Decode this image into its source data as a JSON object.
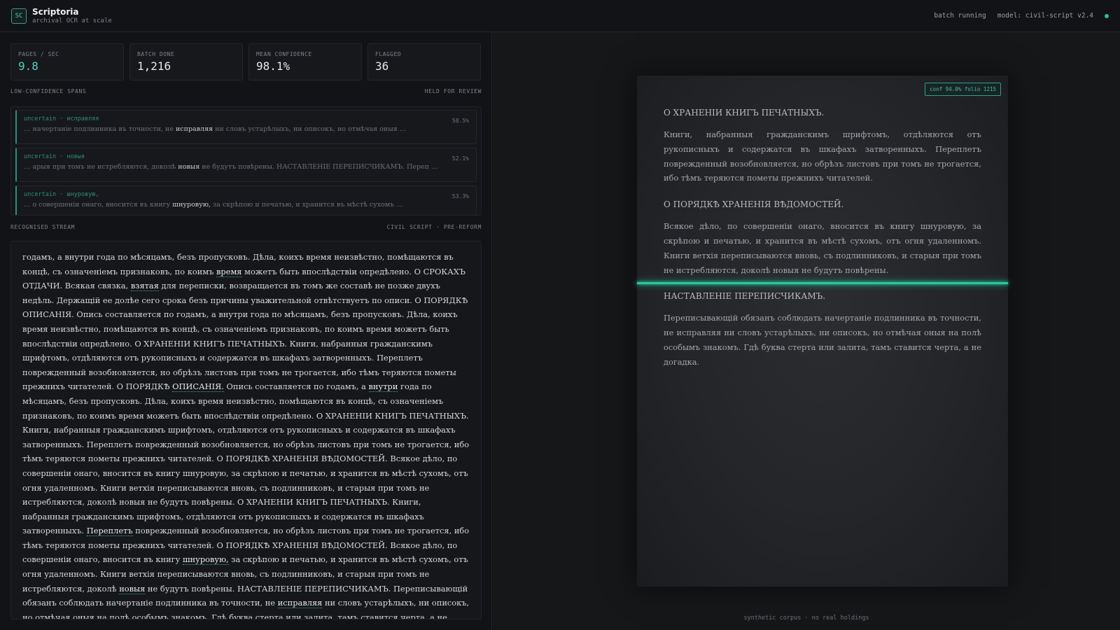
{
  "header": {
    "logo": "SC",
    "title": "Scriptoria",
    "subtitle": "archival OCR at scale",
    "status": "batch running",
    "model": "model: civil-script v2.4",
    "status_color": "#2fbf8f"
  },
  "stats": [
    {
      "label": "PAGES / SEC",
      "value": "9.8"
    },
    {
      "label": "BATCH DONE",
      "value": "1,216"
    },
    {
      "label": "MEAN CONFIDENCE",
      "value": "98.1%"
    },
    {
      "label": "FLAGGED",
      "value": "36"
    }
  ],
  "low_conf": {
    "title": "LOW-CONFIDENCE SPANS",
    "right": "HELD FOR REVIEW",
    "items": [
      {
        "tag": "uncertain · исправляя",
        "pct": "58.5%",
        "pre": "… начертаніе подлинника въ точности, не ",
        "word": "исправляя",
        "post": " ни словъ устарѣлыхъ, ни описокъ, но отмѣчая оныя …"
      },
      {
        "tag": "uncertain · новыя",
        "pct": "52.1%",
        "pre": "… арыя при томъ не истребляются, доколѣ ",
        "word": "новыя",
        "post": " не будутъ повѣрены. НАСТАВЛЕНІЕ ПЕРЕПИСЧИКАМЪ. Переп …"
      },
      {
        "tag": "uncertain · шнуровую,",
        "pct": "53.3%",
        "pre": "… о совершеніи онаго, вносится въ книгу ",
        "word": "шнуровую,",
        "post": " за скрѣпою и печатью, и хранится въ мѣстѣ сухомъ …"
      }
    ]
  },
  "stream": {
    "title": "RECOGNISED STREAM",
    "right": "CIVIL SCRIPT · PRE-REFORM",
    "segments": [
      {
        "t": "годамъ, а внутри года по мѣсяцамъ, безъ пропусковъ. Дѣла, коихъ время неизвѣстно, помѣщаются въ концѣ, съ означеніемъ признаковъ, по коимъ "
      },
      {
        "t": "время",
        "u": true
      },
      {
        "t": " можетъ быть впослѣдствіи опредѣлено. О СРОКАХЪ ОТДАЧИ. Всякая связка, "
      },
      {
        "t": "взятая",
        "u": true
      },
      {
        "t": " для переписки, возвращается въ томъ же составѣ не позже двухъ недѣль. Держащій ее долѣе сего срока безъ причины уважительной отвѣтствуетъ по описи. О ПОРЯДКѢ ОПИСАНІЯ. Опись составляется по годамъ, а внутри года по мѣсяцамъ, безъ пропусковъ. Дѣла, коихъ время неизвѣстно, помѣщаются въ концѣ, съ означеніемъ признаковъ, по коимъ время можетъ быть впослѣдствіи опредѣлено. О ХРАНЕНІИ КНИГЪ ПЕЧАТНЫХЪ. Книги, набранныя гражданскимъ шрифтомъ, отдѣляются отъ рукописныхъ и содержатся въ шкафахъ затворенныхъ. Переплетъ поврежденный возобновляется, но обрѣзъ листовъ при томъ не трогается, ибо тѣмъ теряются пометы прежнихъ читателей. О ПОРЯДКѢ "
      },
      {
        "t": "ОПИСАНІЯ.",
        "u": true
      },
      {
        "t": " Опись составляется по годамъ, а "
      },
      {
        "t": "внутри",
        "u": true
      },
      {
        "t": " года по мѣсяцамъ, безъ пропусковъ. Дѣла, коихъ время неизвѣстно, помѣщаются въ концѣ, съ означеніемъ признаковъ, по коимъ время можетъ быть впослѣдствіи опредѣлено. О ХРАНЕНІИ КНИГЪ ПЕЧАТНЫХЪ. Книги, набранныя гражданскимъ шрифтомъ, отдѣляются отъ рукописныхъ и содержатся въ шкафахъ затворенныхъ. Переплетъ поврежденный возобновляется, но обрѣзъ листовъ при томъ не трогается, ибо тѣмъ теряются пометы прежнихъ читателей. О ПОРЯДКѢ ХРАНЕНІЯ ВѢДОМОСТЕЙ. Всякое дѣло, по совершеніи онаго, вносится въ книгу шнуровую, за скрѣпою и печатью, и хранится въ мѣстѣ сухомъ, отъ огня удаленномъ. Книги ветхія переписываются вновь, съ подлинниковъ, и старыя при томъ не истребляются, доколѣ новыя не будутъ повѣрены. О ХРАНЕНІИ КНИГЪ ПЕЧАТНЫХЪ. Книги, набранныя гражданскимъ шрифтомъ, отдѣляются отъ рукописныхъ и содержатся въ шкафахъ затворенныхъ. "
      },
      {
        "t": "Переплетъ",
        "u": true
      },
      {
        "t": " поврежденный возобновляется, но обрѣзъ листовъ при томъ не трогается, ибо тѣмъ теряются пометы прежнихъ читателей. О ПОРЯДКѢ ХРАНЕНІЯ ВѢДОМОСТЕЙ. Всякое дѣло, по совершеніи онаго, вносится въ книгу "
      },
      {
        "t": "шнуровую,",
        "u": true
      },
      {
        "t": " за скрѣпою и печатью, и хранится въ мѣстѣ сухомъ, отъ огня удаленномъ. Книги ветхія переписываются вновь, съ подлинниковъ, и старыя при томъ не истребляются, доколѣ "
      },
      {
        "t": "новыя",
        "u": true
      },
      {
        "t": " не будутъ повѣрены. НАСТАВЛЕНІЕ ПЕРЕПИСЧИКАМЪ. Переписывающій обязанъ соблюдать начертаніе подлинника въ точности, не "
      },
      {
        "t": "исправляя",
        "u": true
      },
      {
        "t": " ни словъ устарѣлыхъ, ни описокъ, но отмѣчая оныя на полѣ особымъ знакомъ. Гдѣ буква стерта или залита, тамъ ставится черта, а не догадка."
      }
    ]
  },
  "page": {
    "badge": "conf 94.0% folio 1215",
    "sections": [
      {
        "heading": "О ХРАНЕНІИ КНИГЪ ПЕЧАТНЫХЪ.",
        "body": "Книги, набранныя гражданскимъ шрифтомъ, отдѣляются отъ рукописныхъ и содержатся въ шкафахъ затворенныхъ. Переплетъ поврежденный возобновляется, но обрѣзъ листовъ при томъ не трогается, ибо тѣмъ теряются пометы прежнихъ читателей."
      },
      {
        "heading": "О ПОРЯДКѢ ХРАНЕНІЯ ВѢДОМОСТЕЙ.",
        "body": "Всякое дѣло, по совершеніи онаго, вносится въ книгу шнуровую, за скрѣпою и печатью, и хранится въ мѣстѣ сухомъ, отъ огня удаленномъ. Книги ветхія переписываются вновь, съ подлинниковъ, и старыя при томъ не истребляются, доколѣ новыя не будутъ повѣрены."
      },
      {
        "heading": "НАСТАВЛЕНІЕ ПЕРЕПИСЧИКАМЪ.",
        "body": "Переписывающій обязанъ соблюдать начертаніе подлинника въ точности, не исправляя ни словъ устарѣлыхъ, ни описокъ, но отмѣчая оныя на полѣ особымъ знакомъ. Гдѣ буква стерта или залита, тамъ ставится черта, а не догадка."
      }
    ],
    "scan_color": "#27c79e"
  },
  "footer": "synthetic corpus · no real holdings"
}
